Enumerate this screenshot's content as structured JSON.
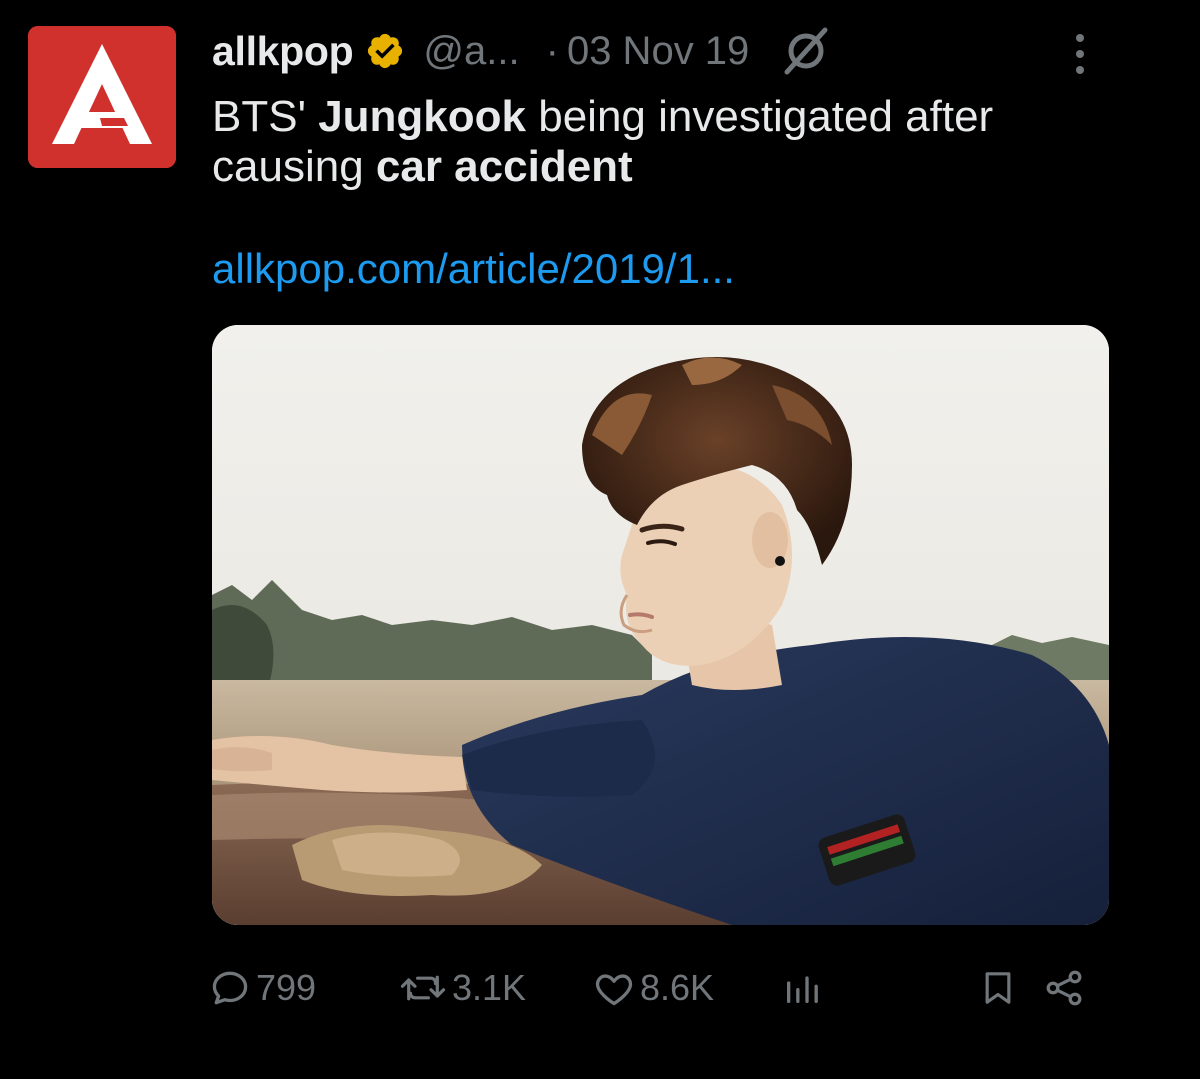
{
  "tweet": {
    "author": {
      "display_name": "allkpop",
      "handle": "@a...",
      "avatar_color": "#d0312d",
      "verified_badge_color": "#e8b100"
    },
    "separator": "·",
    "date": "03 Nov 19",
    "text": {
      "part1": "BTS' ",
      "bold1": "Jungkook",
      "part2": " being investigated after causing ",
      "bold2": "car accident"
    },
    "link": "allkpop.com/article/2019/1...",
    "link_color": "#1d9bf0",
    "media": {
      "type": "photo"
    }
  },
  "actions": {
    "reply": {
      "icon": "reply-icon",
      "count": "799"
    },
    "retweet": {
      "icon": "retweet-icon",
      "count": "3.1K"
    },
    "like": {
      "icon": "heart-icon",
      "count": "8.6K"
    },
    "views": {
      "icon": "views-icon"
    },
    "bookmark": {
      "icon": "bookmark-icon"
    },
    "share": {
      "icon": "share-icon"
    }
  },
  "colors": {
    "background": "#000000",
    "text": "#e7e9ea",
    "muted": "#71767b"
  }
}
